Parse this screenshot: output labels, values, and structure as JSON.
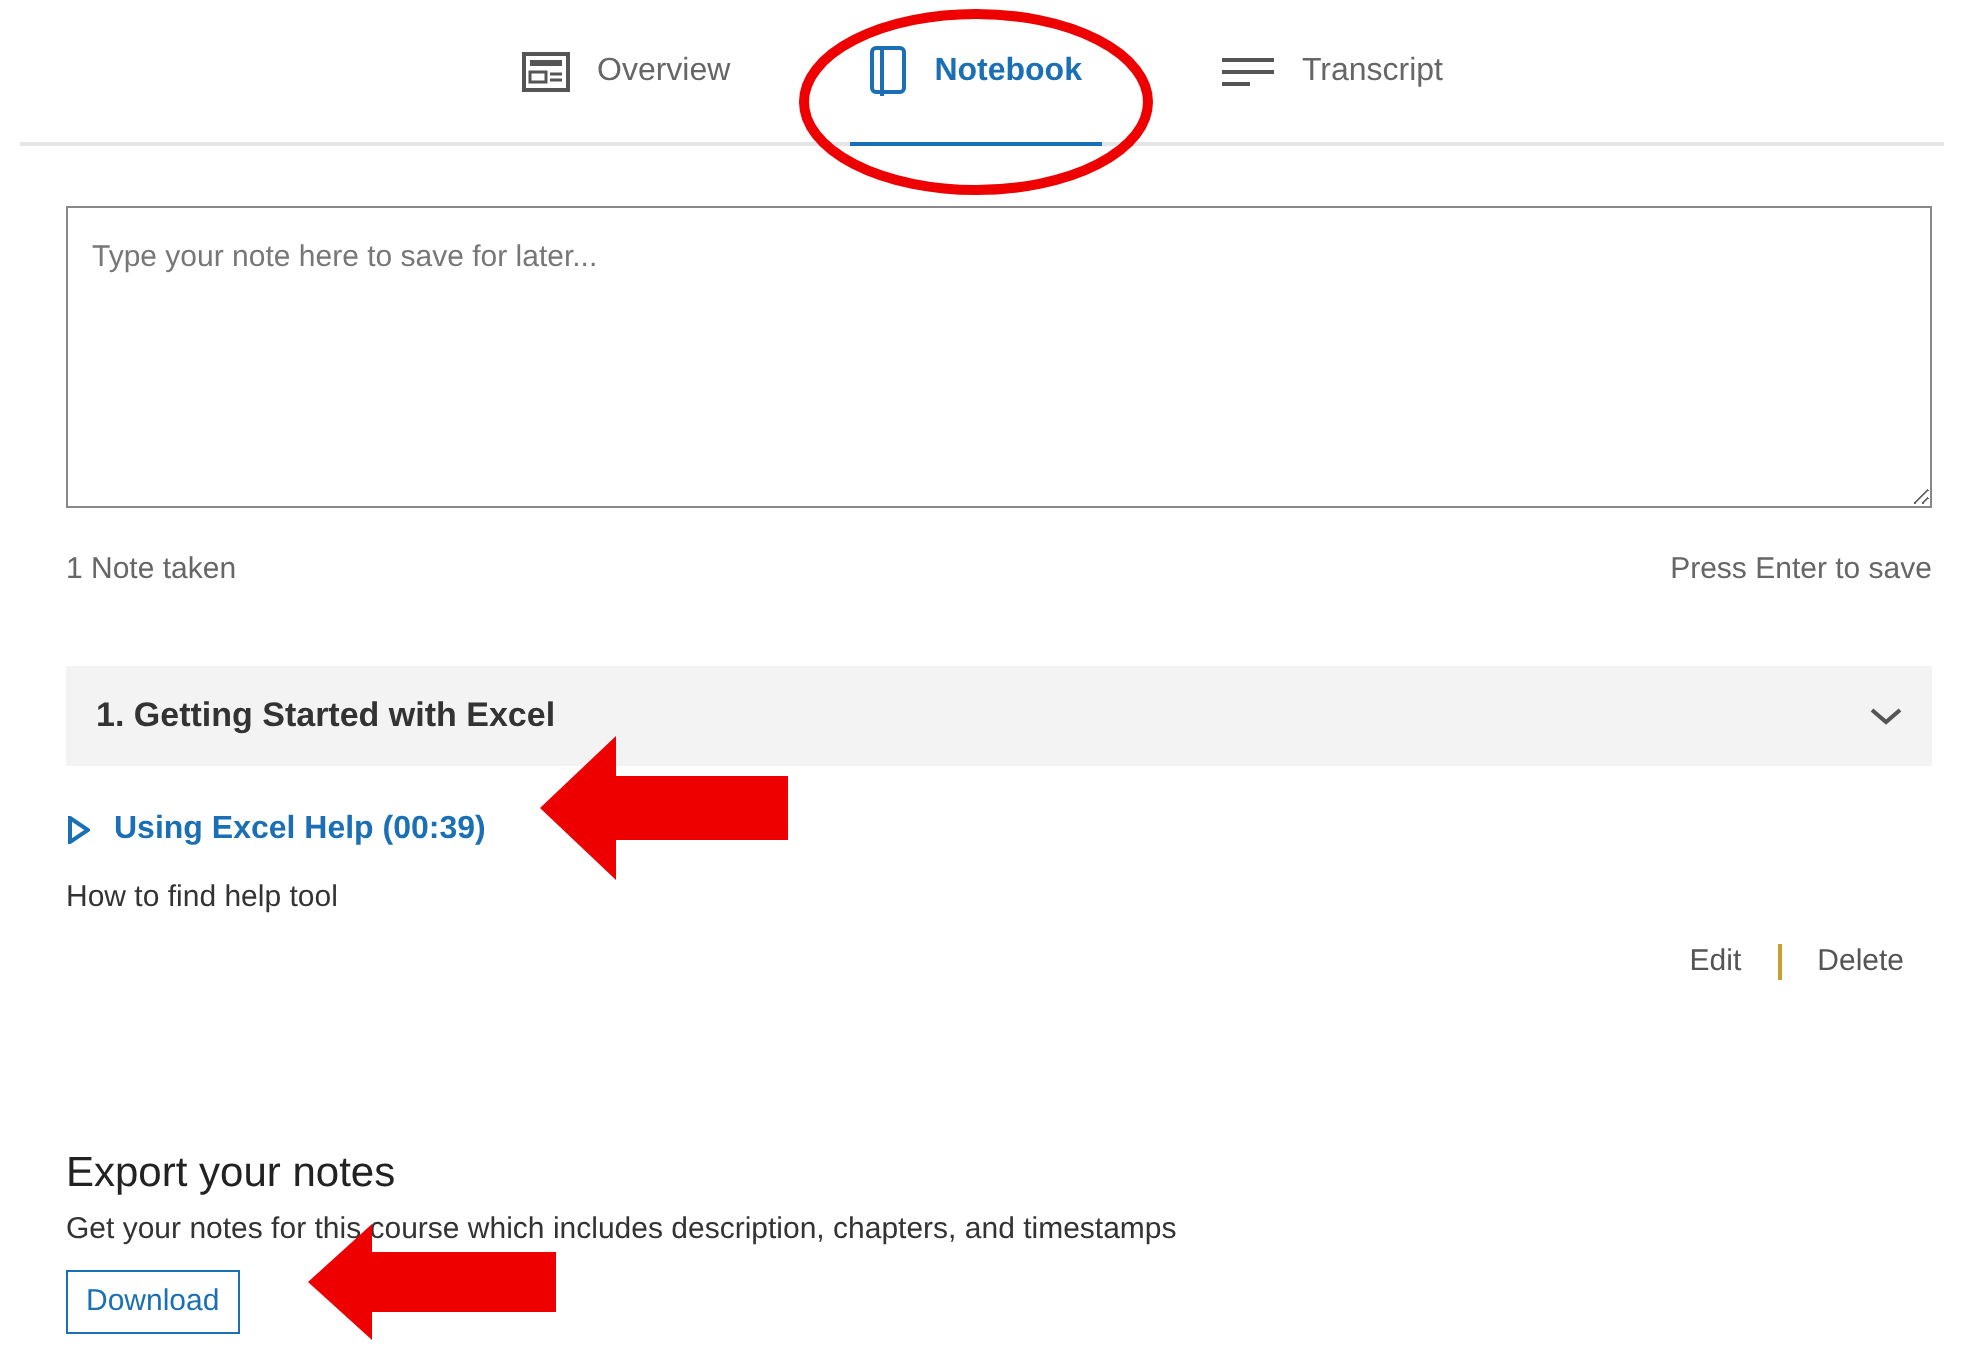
{
  "tabs": [
    {
      "label": "Overview",
      "selected": false
    },
    {
      "label": "Notebook",
      "selected": true
    },
    {
      "label": "Transcript",
      "selected": false
    }
  ],
  "note_input": {
    "placeholder": "Type your note here to save for later..."
  },
  "note_count": "1 Note taken",
  "save_hint": "Press Enter to save",
  "chapter": {
    "title": "1. Getting Started with Excel",
    "expanded": true,
    "notes": [
      {
        "video": "Using Excel Help (00:39)",
        "text": "How to find help tool",
        "actions": [
          "Edit",
          "Delete"
        ]
      }
    ]
  },
  "export": {
    "heading": "Export your notes",
    "description": "Get your notes for this course which includes description, chapters, and timestamps",
    "button": "Download"
  }
}
